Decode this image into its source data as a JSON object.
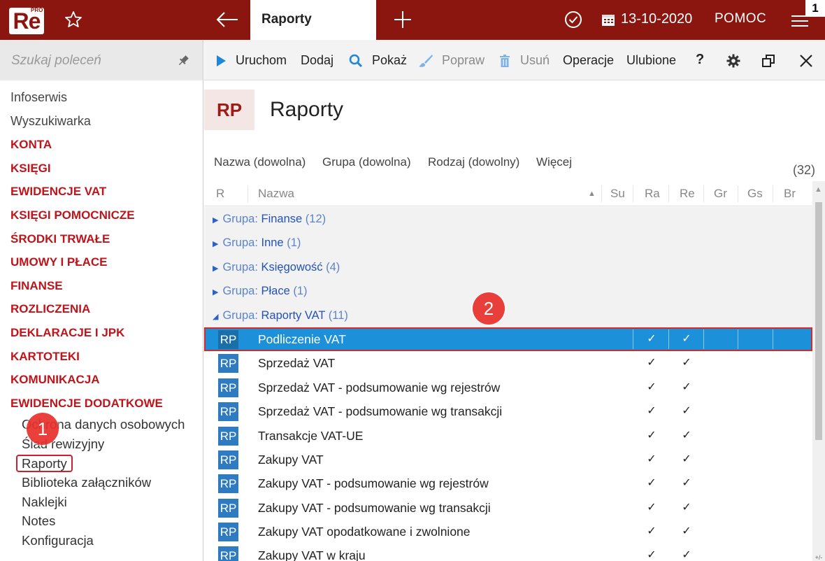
{
  "app": {
    "logo_text": "Re",
    "logo_pro": "PRO",
    "active_tab": "Raporty",
    "date": "13-10-2020",
    "help_label": "POMOC",
    "badge": "1"
  },
  "sidebar": {
    "search_placeholder": "Szukaj poleceń",
    "items": [
      {
        "label": "Infoserwis",
        "kind": "plain"
      },
      {
        "label": "Wyszukiwarka",
        "kind": "plain"
      },
      {
        "label": "KONTA",
        "kind": "section"
      },
      {
        "label": "KSIĘGI",
        "kind": "section"
      },
      {
        "label": "EWIDENCJE VAT",
        "kind": "section"
      },
      {
        "label": "KSIĘGI POMOCNICZE",
        "kind": "section"
      },
      {
        "label": "ŚRODKI TRWAŁE",
        "kind": "section"
      },
      {
        "label": "UMOWY I PŁACE",
        "kind": "section"
      },
      {
        "label": "FINANSE",
        "kind": "section"
      },
      {
        "label": "ROZLICZENIA",
        "kind": "section"
      },
      {
        "label": "DEKLARACJE I JPK",
        "kind": "section"
      },
      {
        "label": "KARTOTEKI",
        "kind": "section"
      },
      {
        "label": "KOMUNIKACJA",
        "kind": "section"
      },
      {
        "label": "EWIDENCJE DODATKOWE",
        "kind": "section"
      }
    ],
    "subitems": [
      {
        "label": "Ochrona danych osobowych"
      },
      {
        "label": "Ślad rewizyjny"
      },
      {
        "label": "Raporty",
        "selected": true
      },
      {
        "label": "Biblioteka załączników"
      },
      {
        "label": "Naklejki"
      },
      {
        "label": "Notes"
      },
      {
        "label": "Konfiguracja"
      }
    ]
  },
  "toolbar": {
    "run": "Uruchom",
    "add": "Dodaj",
    "show": "Pokaż",
    "edit": "Popraw",
    "delete": "Usuń",
    "operations": "Operacje",
    "favorites": "Ulubione",
    "help": "?"
  },
  "page": {
    "code": "RP",
    "title": "Raporty"
  },
  "filters": {
    "name": "Nazwa (dowolna)",
    "group": "Grupa (dowolna)",
    "kind": "Rodzaj (dowolny)",
    "more": "Więcej",
    "count": "(32)"
  },
  "table": {
    "headers": {
      "r": "R",
      "name": "Nazwa",
      "su": "Su",
      "ra": "Ra",
      "re": "Re",
      "gr": "Gr",
      "gs": "Gs",
      "br": "Br"
    },
    "groups": [
      {
        "label": "Grupa",
        "name": "Finanse",
        "count": "(12)",
        "expanded": false
      },
      {
        "label": "Grupa",
        "name": "Inne",
        "count": "(1)",
        "expanded": false
      },
      {
        "label": "Grupa",
        "name": "Księgowość",
        "count": "(4)",
        "expanded": false
      },
      {
        "label": "Grupa",
        "name": "Płace",
        "count": "(1)",
        "expanded": false
      },
      {
        "label": "Grupa",
        "name": "Raporty VAT",
        "count": "(11)",
        "expanded": true
      }
    ],
    "rows": [
      {
        "code": "RP",
        "name": "Podliczenie VAT",
        "ra": "✓",
        "re": "✓",
        "selected": true
      },
      {
        "code": "RP",
        "name": "Sprzedaż VAT",
        "ra": "✓",
        "re": "✓"
      },
      {
        "code": "RP",
        "name": "Sprzedaż VAT - podsumowanie wg rejestrów",
        "ra": "✓",
        "re": "✓"
      },
      {
        "code": "RP",
        "name": "Sprzedaż VAT - podsumowanie wg transakcji",
        "ra": "✓",
        "re": "✓"
      },
      {
        "code": "RP",
        "name": "Transakcje VAT-UE",
        "ra": "✓",
        "re": "✓"
      },
      {
        "code": "RP",
        "name": "Zakupy VAT",
        "ra": "✓",
        "re": "✓"
      },
      {
        "code": "RP",
        "name": "Zakupy VAT - podsumowanie wg rejestrów",
        "ra": "✓",
        "re": "✓"
      },
      {
        "code": "RP",
        "name": "Zakupy VAT - podsumowanie wg transakcji",
        "ra": "✓",
        "re": "✓"
      },
      {
        "code": "RP",
        "name": "Zakupy VAT opodatkowane i zwolnione",
        "ra": "✓",
        "re": "✓"
      },
      {
        "code": "RP",
        "name": "Zakupy VAT w kraju",
        "ra": "✓",
        "re": "✓"
      }
    ]
  },
  "scroll": {
    "foot": "+/-"
  },
  "annotations": {
    "marker1": "1",
    "marker2": "2"
  },
  "colors": {
    "brand": "#8b1610",
    "section": "#c0141b",
    "selection": "#1c90d8",
    "link": "#2452b8"
  }
}
